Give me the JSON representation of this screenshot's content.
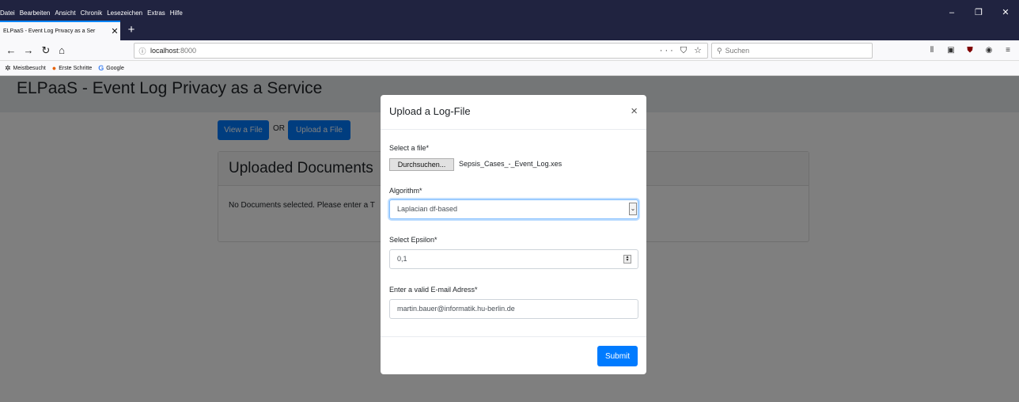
{
  "menu": [
    "Datei",
    "Bearbeiten",
    "Ansicht",
    "Chronik",
    "Lesezeichen",
    "Extras",
    "Hilfe"
  ],
  "window_controls": [
    "–",
    "❐",
    "✕"
  ],
  "tab": {
    "title": "ELPaaS - Event Log Privacy as a Ser",
    "close": "✕",
    "new": "+"
  },
  "nav": {
    "back": "←",
    "forward": "→",
    "reload": "↻",
    "home": "⌂",
    "info": "ⓘ",
    "url_host": "localhost",
    "url_port": ":8000",
    "url_actions": "··· ⛉ ☆",
    "search_placeholder": "Suchen",
    "toolbar": [
      "⫴",
      "▣",
      "⛊",
      "◉",
      "≡"
    ]
  },
  "bookmarks": [
    {
      "icon": "✲",
      "label": "Meistbesucht"
    },
    {
      "icon": "●",
      "label": "Erste Schritte"
    },
    {
      "icon": "G",
      "label": "Google"
    }
  ],
  "page": {
    "title": "ELPaaS - Event Log Privacy as a Service",
    "view_button": "View a File",
    "or_label": "OR",
    "upload_button": "Upload a File",
    "card_title": "Uploaded Documents",
    "card_text": "No Documents selected. Please enter a T"
  },
  "modal": {
    "title": "Upload a Log-File",
    "close": "×",
    "file_label": "Select a file*",
    "file_button": "Durchsuchen...",
    "file_name": "Sepsis_Cases_-_Event_Log.xes",
    "algorithm_label": "Algorithm*",
    "algorithm_value": "Laplacian df-based",
    "epsilon_label": "Select Epsilon*",
    "epsilon_value": "0,1",
    "email_label": "Enter a valid E-mail Adress*",
    "email_value": "martin.bauer@informatik.hu-berlin.de",
    "submit": "Submit"
  },
  "colors": {
    "primary": "#007bff",
    "chrome_dark": "#202340",
    "tab_accent": "#0a84ff"
  }
}
